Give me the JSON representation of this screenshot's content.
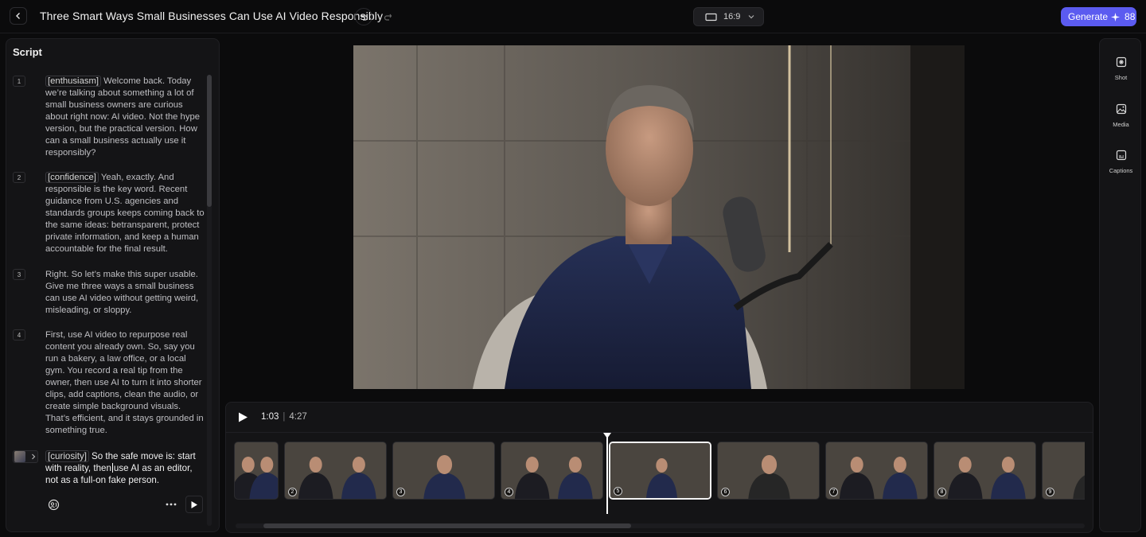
{
  "header": {
    "title": "Three Smart Ways Small Businesses Can Use AI Video Responsibly",
    "aspect_ratio": "16:9",
    "generate_label": "Generate",
    "credits": "88",
    "accent_color": "#5b5bf0"
  },
  "script": {
    "heading": "Script",
    "blocks": [
      {
        "number": "1",
        "tag": "[enthusiasm]",
        "text": "Welcome back. Today we’re talking about something a lot of small business owners are curious about right now: AI video. Not the hype version, but the practical version. How can a small business actually use it responsibly?"
      },
      {
        "number": "2",
        "tag": "[confidence]",
        "text": "Yeah, exactly. And responsible is the key word. Recent guidance from U.S. agencies and standards groups keeps coming back to the same ideas: betransparent, protect private information, and keep a human accountable for the final result."
      },
      {
        "number": "3",
        "tag": "",
        "text": "Right. So let’s make this super usable. Give me three ways a small business can use AI video without getting weird, misleading, or sloppy."
      },
      {
        "number": "4",
        "tag": "",
        "text": "First, use AI video to repurpose real content you already own. So, say you run a bakery, a law office, or a local gym. You record a real tip from the owner, then use AI to turn it into shorter clips, add captions, clean the audio, or create simple background visuals. That’s efficient, and it stays grounded in something true."
      },
      {
        "tag": "[curiosity]",
        "text_before": "So the safe move is: start with reality, then",
        "text_after": "use AI as an editor, not as a full-on fake person."
      }
    ]
  },
  "player": {
    "current_time": "1:03",
    "separator": "|",
    "total_time": "4:27",
    "progress": 0.236
  },
  "timeline": {
    "clips": [
      {
        "number": "",
        "people": "duo"
      },
      {
        "number": "2",
        "people": "duo"
      },
      {
        "number": "3",
        "people": "man"
      },
      {
        "number": "4",
        "people": "duo"
      },
      {
        "number": "5",
        "people": "man-wide",
        "selected": true
      },
      {
        "number": "6",
        "people": "woman"
      },
      {
        "number": "7",
        "people": "duo"
      },
      {
        "number": "8",
        "people": "duo"
      },
      {
        "number": "9",
        "people": "woman"
      }
    ]
  },
  "rail": {
    "items": [
      {
        "label": "Shot",
        "icon": "shot-icon"
      },
      {
        "label": "Media",
        "icon": "media-icon"
      },
      {
        "label": "Captions",
        "icon": "captions-icon"
      }
    ]
  }
}
